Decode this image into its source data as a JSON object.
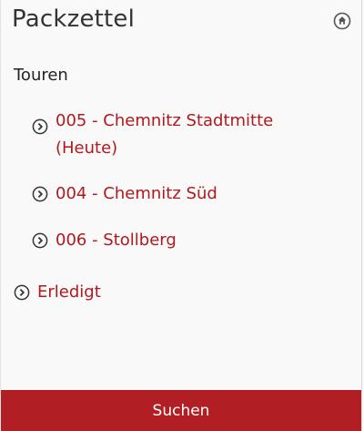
{
  "header": {
    "title": "Packzettel",
    "home_icon": "home-circle-icon"
  },
  "touren": {
    "heading": "Touren",
    "items": [
      {
        "label": "005 - Chemnitz Stadtmitte (Heute)",
        "icon": "chevron-right-circle-icon"
      },
      {
        "label": "004 - Chemnitz Süd",
        "icon": "chevron-right-circle-icon"
      },
      {
        "label": "006 - Stollberg",
        "icon": "chevron-right-circle-icon"
      }
    ]
  },
  "erledigt": {
    "label": "Erledigt",
    "icon": "chevron-right-circle-icon"
  },
  "footer": {
    "search_label": "Suchen"
  },
  "colors": {
    "accent": "#b0191e",
    "footer_bg": "#b11e23",
    "background": "#f9f9f9"
  }
}
